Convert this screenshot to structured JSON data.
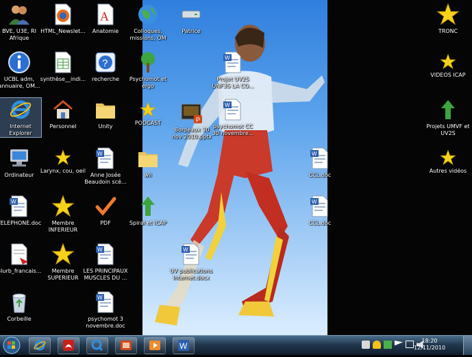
{
  "desktop": {
    "icons": [
      {
        "label": "BVE, U3E, RI Afrique",
        "icon": "users-icon"
      },
      {
        "label": "HTML_Newslet...",
        "icon": "firefox-icon"
      },
      {
        "label": "Anatomie",
        "icon": "document-a-icon"
      },
      {
        "label": "Colloques, missions, OM",
        "icon": "globe-icon"
      },
      {
        "label": "Patrice",
        "icon": "drive-icon"
      },
      {
        "label": "UCBL adm, annuaire, OM...",
        "icon": "info-icon"
      },
      {
        "label": "synthèse__indi...",
        "icon": "spreadsheet-icon"
      },
      {
        "label": "recherche",
        "icon": "help-icon"
      },
      {
        "label": "Psychomot et ergo",
        "icon": "tree-icon"
      },
      {
        "label": "Projet UV2S UNF3S LA CO...",
        "icon": "word-doc-icon"
      },
      {
        "label": "Internet Explorer",
        "icon": "ie-icon"
      },
      {
        "label": "Personnel",
        "icon": "home-icon"
      },
      {
        "label": "Unity",
        "icon": "folder-icon"
      },
      {
        "label": "PODCAST",
        "icon": "star-icon"
      },
      {
        "label": "Bordeaux 30 nov 2010.pptx",
        "icon": "pptx-icon"
      },
      {
        "label": "psychomot CC 30 novembre...",
        "icon": "word-doc-icon"
      },
      {
        "label": "Ordinateur",
        "icon": "computer-icon"
      },
      {
        "label": "Larynx, cou, oeil",
        "icon": "star-icon"
      },
      {
        "label": "Anne Josée Beaudoin scé...",
        "icon": "word-doc-icon"
      },
      {
        "label": "wii",
        "icon": "folder-icon"
      },
      {
        "label": "TELEPHONE.doc",
        "icon": "word-doc-icon"
      },
      {
        "label": "Membre INFERIEUR",
        "icon": "star-icon"
      },
      {
        "label": "PDF",
        "icon": "checkmark-icon"
      },
      {
        "label": "Spiral et ICAP",
        "icon": "green-arrow-icon"
      },
      {
        "label": "Blurb_francais...",
        "icon": "pdf-doc-icon"
      },
      {
        "label": "Membre SUPERIEUR",
        "icon": "star-icon"
      },
      {
        "label": "LES PRINCIPAUX MUSCLES DU ...",
        "icon": "word-doc-icon"
      },
      {
        "label": "UV publications Internet.docx",
        "icon": "word-doc-icon"
      },
      {
        "label": "Corbeille",
        "icon": "recycle-bin-icon"
      },
      {
        "label": "psychomot 3 novembre.doc",
        "icon": "word-doc-icon"
      },
      {
        "label": "CCL.doc",
        "icon": "word-doc-icon"
      },
      {
        "label": "CCL.doc",
        "icon": "word-doc-icon"
      },
      {
        "label": "TRONC",
        "icon": "star-icon"
      },
      {
        "label": "VIDEOS ICAP",
        "icon": "star-icon"
      },
      {
        "label": "Projets UMVF et UV2S",
        "icon": "green-arrow-icon"
      },
      {
        "label": "Autres vidéos",
        "icon": "star-icon"
      }
    ]
  },
  "taskbar": {
    "pinned": [
      "internet-explorer",
      "acrobat",
      "quicktime",
      "powerpoint",
      "media-player",
      "word"
    ],
    "clock_time": "18:20",
    "clock_date": "12/11/2010"
  },
  "colors": {
    "wallpaper_top": "#2f7fde",
    "wallpaper_bottom": "#dbeeff",
    "star": "#f7d21a",
    "taskbar": "#22384f"
  }
}
